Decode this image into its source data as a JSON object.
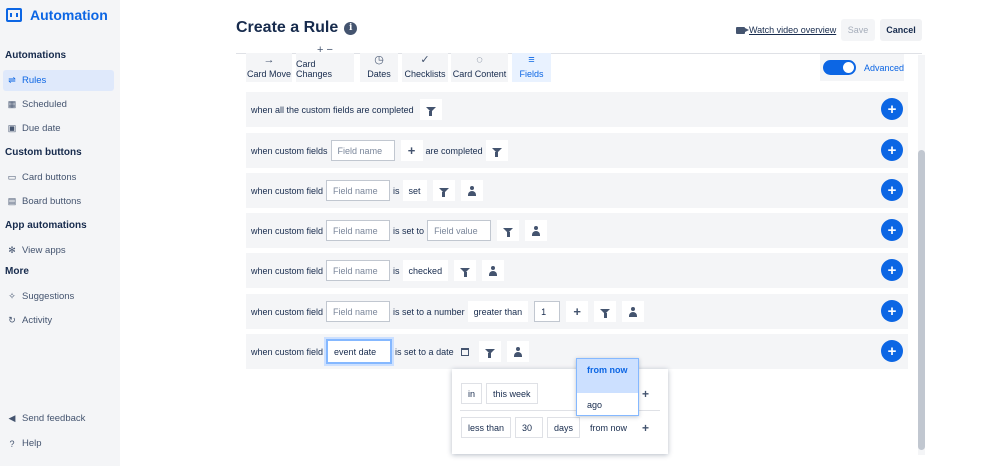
{
  "sidebar": {
    "brand": "Automation",
    "sections": [
      {
        "title": "Automations",
        "items": [
          {
            "label": "Rules",
            "icon": "rules-icon",
            "glyph": "⇌",
            "active": true
          },
          {
            "label": "Scheduled",
            "icon": "calendar-icon",
            "glyph": "▦"
          },
          {
            "label": "Due date",
            "icon": "due-date-icon",
            "glyph": "▣"
          }
        ]
      },
      {
        "title": "Custom buttons",
        "items": [
          {
            "label": "Card buttons",
            "icon": "card-button-icon",
            "glyph": "▭"
          },
          {
            "label": "Board buttons",
            "icon": "board-button-icon",
            "glyph": "▤"
          }
        ]
      },
      {
        "title": "App automations",
        "items": [
          {
            "label": "View apps",
            "icon": "gear-icon",
            "glyph": "✻"
          }
        ]
      },
      {
        "title": "More",
        "items": [
          {
            "label": "Suggestions",
            "icon": "sparkle-icon",
            "glyph": "✧"
          },
          {
            "label": "Activity",
            "icon": "refresh-icon",
            "glyph": "↻"
          }
        ]
      }
    ],
    "footer": [
      {
        "label": "Send feedback",
        "icon": "megaphone-icon",
        "glyph": "◀"
      },
      {
        "label": "Help",
        "icon": "help-icon",
        "glyph": "?"
      }
    ]
  },
  "header": {
    "title": "Create a Rule",
    "video_link": "Watch video overview",
    "save": "Save",
    "cancel": "Cancel"
  },
  "toolbar": {
    "tabs": [
      {
        "label": "Card Move",
        "glyph": "→"
      },
      {
        "label": "Card Changes",
        "glyph": "+ −"
      },
      {
        "label": "Dates",
        "glyph": "◷"
      },
      {
        "label": "Checklists",
        "glyph": "✓"
      },
      {
        "label": "Card Content",
        "glyph": "◌"
      },
      {
        "label": "Fields",
        "glyph": "≡",
        "active": true
      }
    ],
    "advanced_label": "Advanced"
  },
  "rows": {
    "r1": {
      "text": "when all the custom fields are completed"
    },
    "r2": {
      "pre": "when custom fields",
      "placeholder": "Field name",
      "post": "are completed"
    },
    "r3": {
      "pre": "when custom field",
      "placeholder": "Field name",
      "mid": "is",
      "value": "set"
    },
    "r4": {
      "pre": "when custom field",
      "placeholder": "Field name",
      "mid": "is set to",
      "value_placeholder": "Field value"
    },
    "r5": {
      "pre": "when custom field",
      "placeholder": "Field name",
      "mid": "is",
      "value": "checked"
    },
    "r6": {
      "pre": "when custom field",
      "placeholder": "Field name",
      "mid": "is set to a number",
      "comparator": "greater than",
      "number": "1"
    },
    "r7": {
      "pre": "when custom field",
      "field_value": "event date",
      "mid": "is set to a date"
    }
  },
  "date_popup": {
    "row1": {
      "prep": "in",
      "period": "this week"
    },
    "row2": {
      "comparator": "less than",
      "amount": "30",
      "unit": "days",
      "direction": "from now"
    },
    "dropdown": {
      "options": [
        "from now",
        "ago"
      ],
      "selected": "from now"
    }
  }
}
